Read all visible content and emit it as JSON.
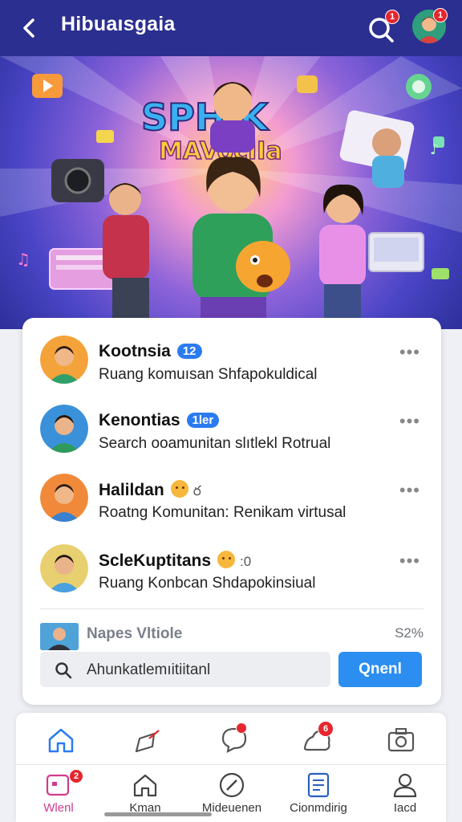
{
  "header": {
    "title": "Hibuaısgaia",
    "search_badge": "1",
    "avatar_badge": "1"
  },
  "banner": {
    "logo_line1": "SPHIK",
    "logo_line2": "MAVocIIa"
  },
  "communities": [
    {
      "name": "Kootnsia",
      "tag": "12",
      "tag_type": "pill",
      "subtitle": "Ruang komuısan Shfapokuldical",
      "more": "•••"
    },
    {
      "name": "Kenontias",
      "tag": "1ler",
      "tag_type": "pill",
      "subtitle": "Search ooamunitan slıtlekl Rotrual",
      "more": "•••"
    },
    {
      "name": "Halildan",
      "tag": "ర",
      "tag_type": "emoji",
      "subtitle": "Roatng Komunitan: Renikam virtusal",
      "more": "•••"
    },
    {
      "name": "ScleKuptitans",
      "tag": ":0",
      "tag_type": "emoji",
      "subtitle": "Ruang Konbcan Shdapokinsiual",
      "more": "•••"
    }
  ],
  "featured": {
    "title": "Napes Vltiole",
    "percent": "S2%"
  },
  "search": {
    "value": "Ahunkatlemıitiitanl",
    "button_label": "Qnenl"
  },
  "quick_actions": [
    {
      "icon": "home-icon"
    },
    {
      "icon": "share-icon"
    },
    {
      "icon": "chat-icon",
      "badge": ""
    },
    {
      "icon": "notification-icon",
      "badge": "6"
    },
    {
      "icon": "camera-icon"
    }
  ],
  "nav": [
    {
      "icon": "grid-icon",
      "label": "Wlenl",
      "badge": "2",
      "active": true
    },
    {
      "icon": "home-icon",
      "label": "Kman"
    },
    {
      "icon": "compass-icon",
      "label": "Mideuenen"
    },
    {
      "icon": "document-icon",
      "label": "Cionmdirig"
    },
    {
      "icon": "profile-icon",
      "label": "Iacd"
    }
  ],
  "colors": {
    "header_bg": "#2b2f8f",
    "accent_blue": "#2b8ef0",
    "pill_blue": "#2b7bf0",
    "badge_red": "#e5262e",
    "active_pink": "#d13b8e"
  }
}
